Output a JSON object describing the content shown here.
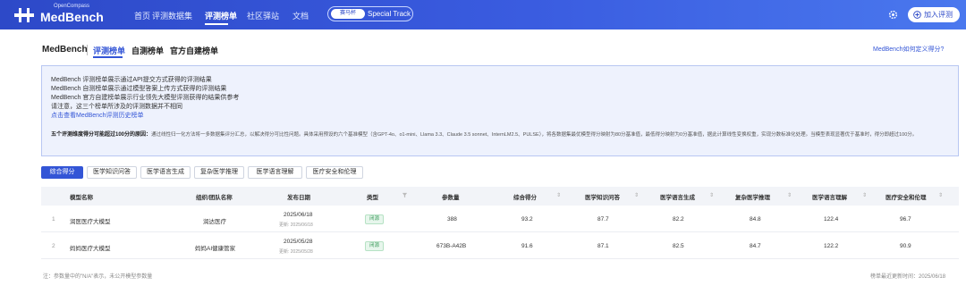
{
  "nav": {
    "logo_sub": "OpenCompass",
    "logo_text": "MedBench",
    "links": [
      "首页",
      "评测数据集",
      "评测榜单",
      "社区驿站",
      "文档"
    ],
    "special_badge": "赛马杯",
    "special_text": "Special Track",
    "join_label": "加入评测"
  },
  "tabs": {
    "brand": "MedBench",
    "items": [
      "评测榜单",
      "自测榜单",
      "官方自建榜单"
    ],
    "help": "MedBench如何定义得分?"
  },
  "info": {
    "lines": [
      "MedBench 评测榜单展示通过API提交方式获得的评测结果",
      "MedBench 自测榜单展示通过模型答案上传方式获得的评测结果",
      "MedBench 官方自建榜单展示行业领先大模型评测获得的结果供参考",
      "请注意，这三个榜单所涉及的评测数据并不相同",
      "点击查看MedBench评测历史榜单"
    ],
    "note_title": "五个评测维度得分可能超过100分的原因：",
    "note_body": "通过线性归一化方法将一多数据集评分汇总，以解决得分可比性问题。具体采用预设的六个基准模型（含GPT-4o、o1-mini、Llama 3.3、Claude 3.5 sonnet、InternLM2.5、PULSE），将各数据集最优模型得分映射为80分基准值，最低得分映射为0分基准值，据此计算线性变换权重，实现分数标准化处理。当模型表现显著优于基准时，得分即超过100分。"
  },
  "filters": [
    "综合得分",
    "医学知识问答",
    "医学语言生成",
    "复杂医学推理",
    "医学语言理解",
    "医疗安全和伦理"
  ],
  "table": {
    "headers": [
      "模型名称",
      "组织/团队名称",
      "发布日期",
      "类型",
      "参数量",
      "综合得分",
      "医学知识问答",
      "医学语言生成",
      "复杂医学推理",
      "医学语言理解",
      "医疗安全和伦理"
    ],
    "rows": [
      {
        "rank": "1",
        "model": "润医医疗大模型",
        "org": "润达医疗",
        "date": "2025/06/18",
        "updated": "更新: 2025/06/18",
        "type": "闭源",
        "params": "388",
        "overall": "93.2",
        "qa": "87.7",
        "gen": "82.2",
        "reason": "84.8",
        "understand": "122.4",
        "safety": "96.7"
      },
      {
        "rank": "2",
        "model": "妈妈医疗大模型",
        "org": "妈妈AI健康管家",
        "date": "2025/05/28",
        "updated": "更新: 2025/05/28",
        "type": "闭源",
        "params": "673B-A42B",
        "overall": "91.6",
        "qa": "87.1",
        "gen": "82.5",
        "reason": "84.7",
        "understand": "122.2",
        "safety": "90.9"
      }
    ]
  },
  "footnote": "注：参数量中的\"N/A\"表示，未公开模型参数量",
  "update": "榜单最近更新时间：2025/06/18",
  "colors": {
    "primary": "#3355d6",
    "nav_bg": "#2d49c8",
    "info_bg": "#eef2fd"
  }
}
